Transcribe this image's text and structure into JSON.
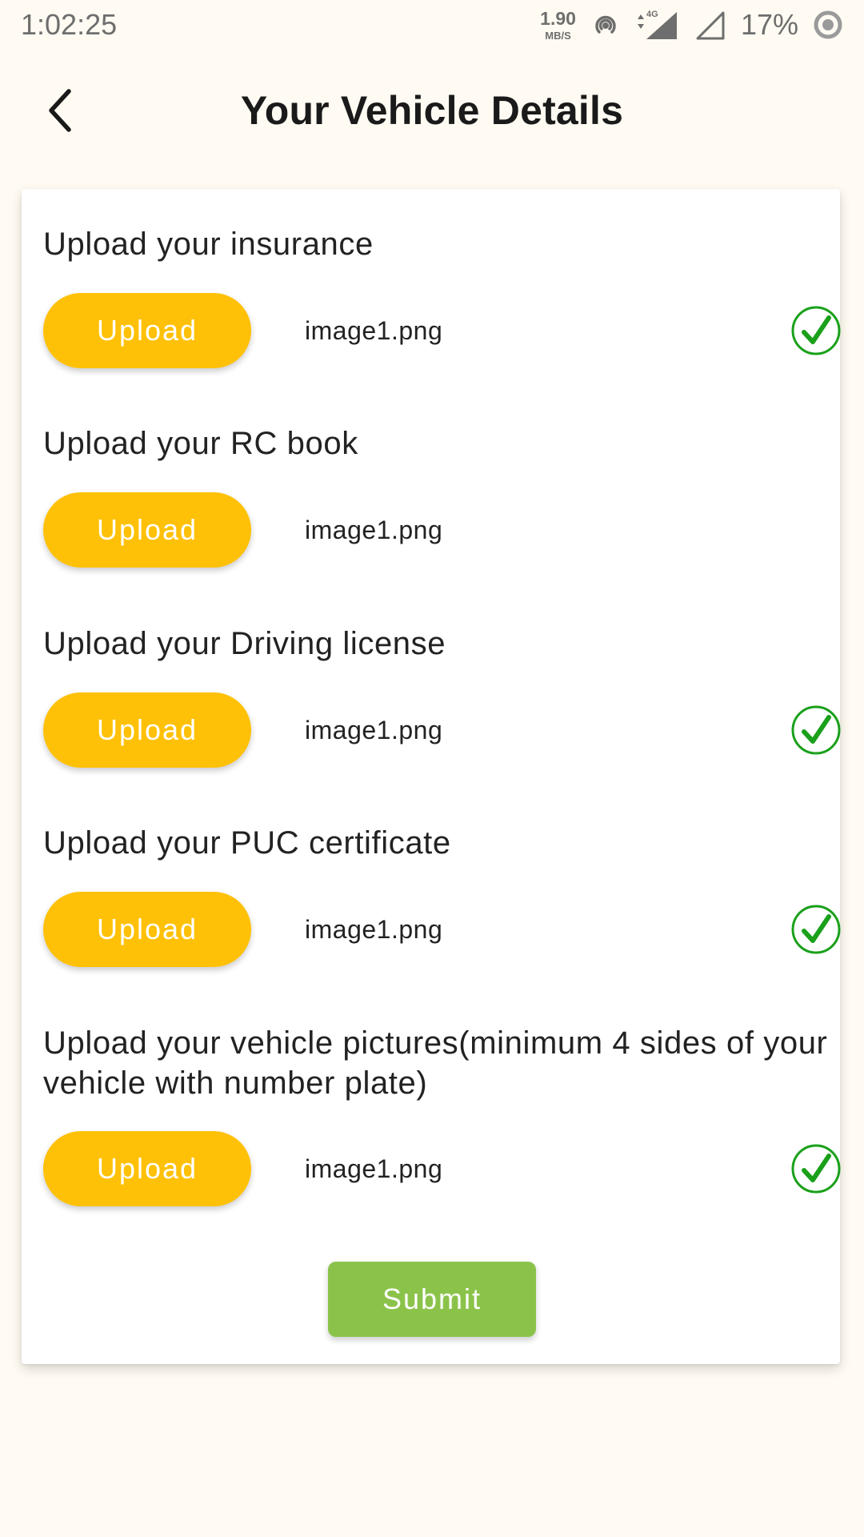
{
  "status_bar": {
    "time": "1:02:25",
    "net_speed_value": "1.90",
    "net_speed_unit": "MB/S",
    "network_type": "4G",
    "battery": "17%",
    "icons": [
      "hotspot-icon",
      "data-arrows-icon",
      "signal-icon",
      "signal-empty-icon",
      "battery-ring-icon"
    ]
  },
  "app_bar": {
    "title": "Your Vehicle Details",
    "back_icon": "back-arrow-icon"
  },
  "colors": {
    "upload_button": "#ffc107",
    "submit_button": "#8bc34a",
    "check": "#1aa01a",
    "background": "#fffbf3"
  },
  "sections": [
    {
      "label": "Upload your insurance",
      "button": "Upload",
      "file": "image1.png",
      "uploaded_check": true
    },
    {
      "label": "Upload your RC book",
      "button": "Upload",
      "file": "image1.png",
      "uploaded_check": false
    },
    {
      "label": "Upload your Driving license",
      "button": "Upload",
      "file": "image1.png",
      "uploaded_check": true
    },
    {
      "label": "Upload your PUC certificate",
      "button": "Upload",
      "file": "image1.png",
      "uploaded_check": true
    },
    {
      "label": "Upload your vehicle pictures(minimum 4 sides of your vehicle with number plate)",
      "button": "Upload",
      "file": "image1.png",
      "uploaded_check": true
    }
  ],
  "submit_label": "Submit"
}
